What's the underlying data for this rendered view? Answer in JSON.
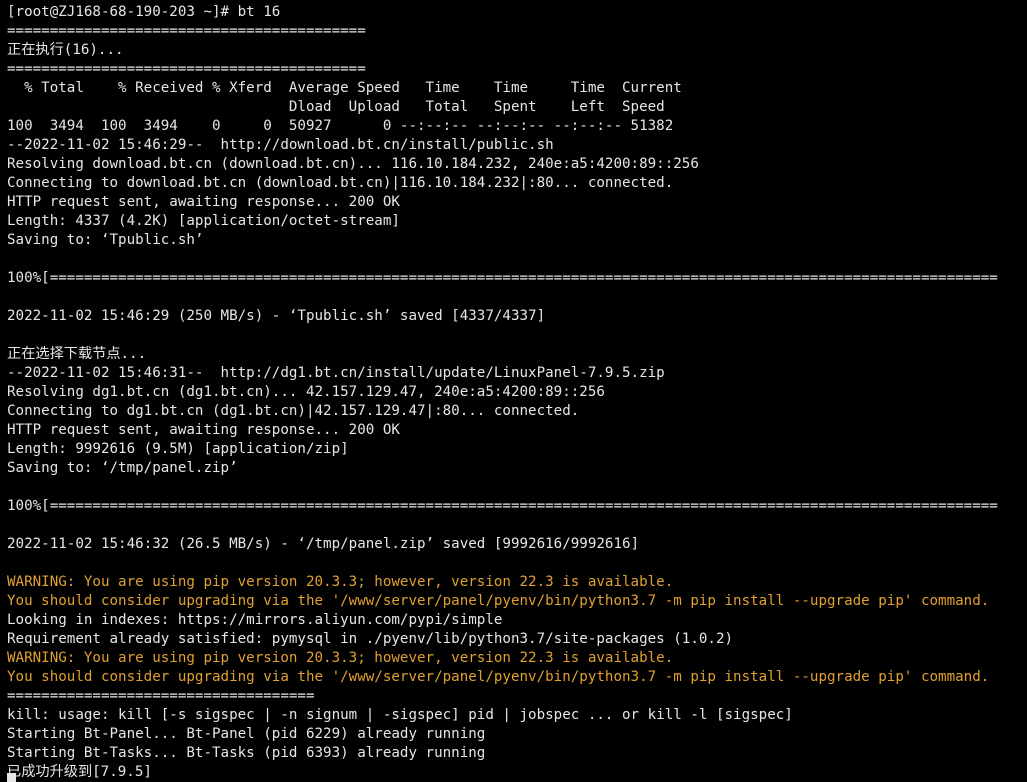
{
  "terminal": {
    "lines": [
      {
        "text": "[root@ZJ168-68-190-203 ~]# bt 16",
        "kind": "normal"
      },
      {
        "text": "==========================================",
        "kind": "normal"
      },
      {
        "text": "正在执行(16)...",
        "kind": "normal"
      },
      {
        "text": "==========================================",
        "kind": "normal"
      },
      {
        "text": "  % Total    % Received % Xferd  Average Speed   Time    Time     Time  Current",
        "kind": "normal"
      },
      {
        "text": "                                 Dload  Upload   Total   Spent    Left  Speed",
        "kind": "normal"
      },
      {
        "text": "100  3494  100  3494    0     0  50927      0 --:--:-- --:--:-- --:--:-- 51382",
        "kind": "normal"
      },
      {
        "text": "--2022-11-02 15:46:29--  http://download.bt.cn/install/public.sh",
        "kind": "normal"
      },
      {
        "text": "Resolving download.bt.cn (download.bt.cn)... 116.10.184.232, 240e:a5:4200:89::256",
        "kind": "normal"
      },
      {
        "text": "Connecting to download.bt.cn (download.bt.cn)|116.10.184.232|:80... connected.",
        "kind": "normal"
      },
      {
        "text": "HTTP request sent, awaiting response... 200 OK",
        "kind": "normal"
      },
      {
        "text": "Length: 4337 (4.2K) [application/octet-stream]",
        "kind": "normal"
      },
      {
        "text": "Saving to: ‘Tpublic.sh’",
        "kind": "normal"
      },
      {
        "text": "",
        "kind": "normal"
      },
      {
        "text": "100%[===============================================================================================================",
        "kind": "normal"
      },
      {
        "text": "",
        "kind": "normal"
      },
      {
        "text": "2022-11-02 15:46:29 (250 MB/s) - ‘Tpublic.sh’ saved [4337/4337]",
        "kind": "normal"
      },
      {
        "text": "",
        "kind": "normal"
      },
      {
        "text": "正在选择下载节点...",
        "kind": "normal"
      },
      {
        "text": "--2022-11-02 15:46:31--  http://dg1.bt.cn/install/update/LinuxPanel-7.9.5.zip",
        "kind": "normal"
      },
      {
        "text": "Resolving dg1.bt.cn (dg1.bt.cn)... 42.157.129.47, 240e:a5:4200:89::256",
        "kind": "normal"
      },
      {
        "text": "Connecting to dg1.bt.cn (dg1.bt.cn)|42.157.129.47|:80... connected.",
        "kind": "normal"
      },
      {
        "text": "HTTP request sent, awaiting response... 200 OK",
        "kind": "normal"
      },
      {
        "text": "Length: 9992616 (9.5M) [application/zip]",
        "kind": "normal"
      },
      {
        "text": "Saving to: ‘/tmp/panel.zip’",
        "kind": "normal"
      },
      {
        "text": "",
        "kind": "normal"
      },
      {
        "text": "100%[===============================================================================================================",
        "kind": "normal"
      },
      {
        "text": "",
        "kind": "normal"
      },
      {
        "text": "2022-11-02 15:46:32 (26.5 MB/s) - ‘/tmp/panel.zip’ saved [9992616/9992616]",
        "kind": "normal"
      },
      {
        "text": "",
        "kind": "normal"
      },
      {
        "text": "WARNING: You are using pip version 20.3.3; however, version 22.3 is available.",
        "kind": "warn"
      },
      {
        "text": "You should consider upgrading via the '/www/server/panel/pyenv/bin/python3.7 -m pip install --upgrade pip' command.",
        "kind": "warn"
      },
      {
        "text": "Looking in indexes: https://mirrors.aliyun.com/pypi/simple",
        "kind": "normal"
      },
      {
        "text": "Requirement already satisfied: pymysql in ./pyenv/lib/python3.7/site-packages (1.0.2)",
        "kind": "normal"
      },
      {
        "text": "WARNING: You are using pip version 20.3.3; however, version 22.3 is available.",
        "kind": "warn"
      },
      {
        "text": "You should consider upgrading via the '/www/server/panel/pyenv/bin/python3.7 -m pip install --upgrade pip' command.",
        "kind": "warn"
      },
      {
        "text": "====================================",
        "kind": "normal"
      },
      {
        "text": "kill: usage: kill [-s sigspec | -n signum | -sigspec] pid | jobspec ... or kill -l [sigspec]",
        "kind": "normal"
      },
      {
        "text": "Starting Bt-Panel... Bt-Panel (pid 6229) already running",
        "kind": "normal"
      },
      {
        "text": "Starting Bt-Tasks... Bt-Tasks (pid 6393) already running",
        "kind": "normal"
      },
      {
        "text": "已成功升级到[7.9.5]",
        "kind": "normal"
      }
    ]
  },
  "colors": {
    "background": "#000000",
    "foreground": "#e6e6e6",
    "warning": "#e0a030"
  }
}
